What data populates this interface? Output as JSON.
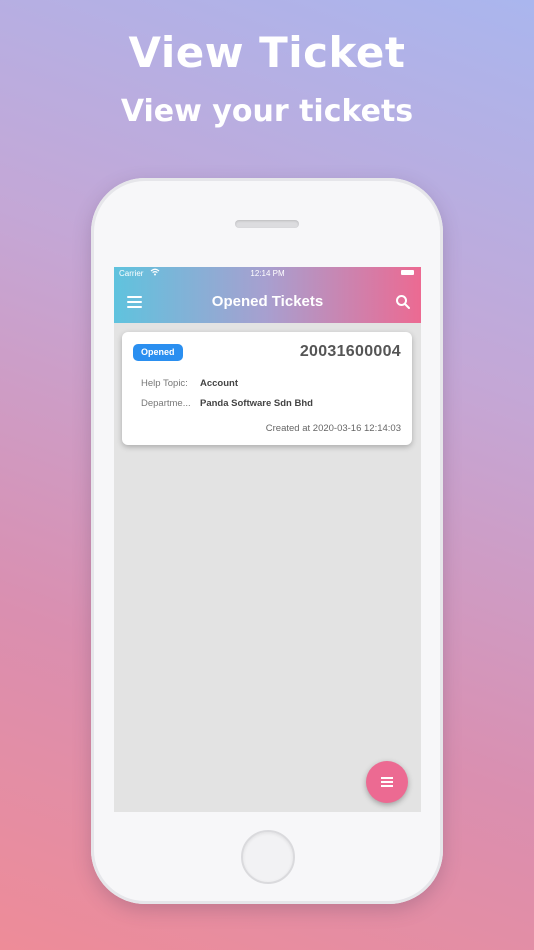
{
  "promo": {
    "title": "View Ticket",
    "subtitle": "View your tickets"
  },
  "status_bar": {
    "carrier": "Carrier",
    "time": "12:14 PM"
  },
  "app_bar": {
    "title": "Opened Tickets"
  },
  "tickets": [
    {
      "status": "Opened",
      "number": "20031600004",
      "help_topic_label": "Help Topic:",
      "help_topic": "Account",
      "department_label": "Departme...",
      "department": "Panda Software Sdn Bhd",
      "created_at": "Created at 2020-03-16 12:14:03"
    }
  ],
  "icons": {
    "menu": "menu-icon",
    "search": "search-icon",
    "wifi": "wifi-icon",
    "battery": "battery-icon",
    "fab": "list-icon"
  },
  "colors": {
    "accent_pink": "#ec6a92",
    "accent_blue": "#5fc3de",
    "badge_blue": "#2a8ff0"
  }
}
